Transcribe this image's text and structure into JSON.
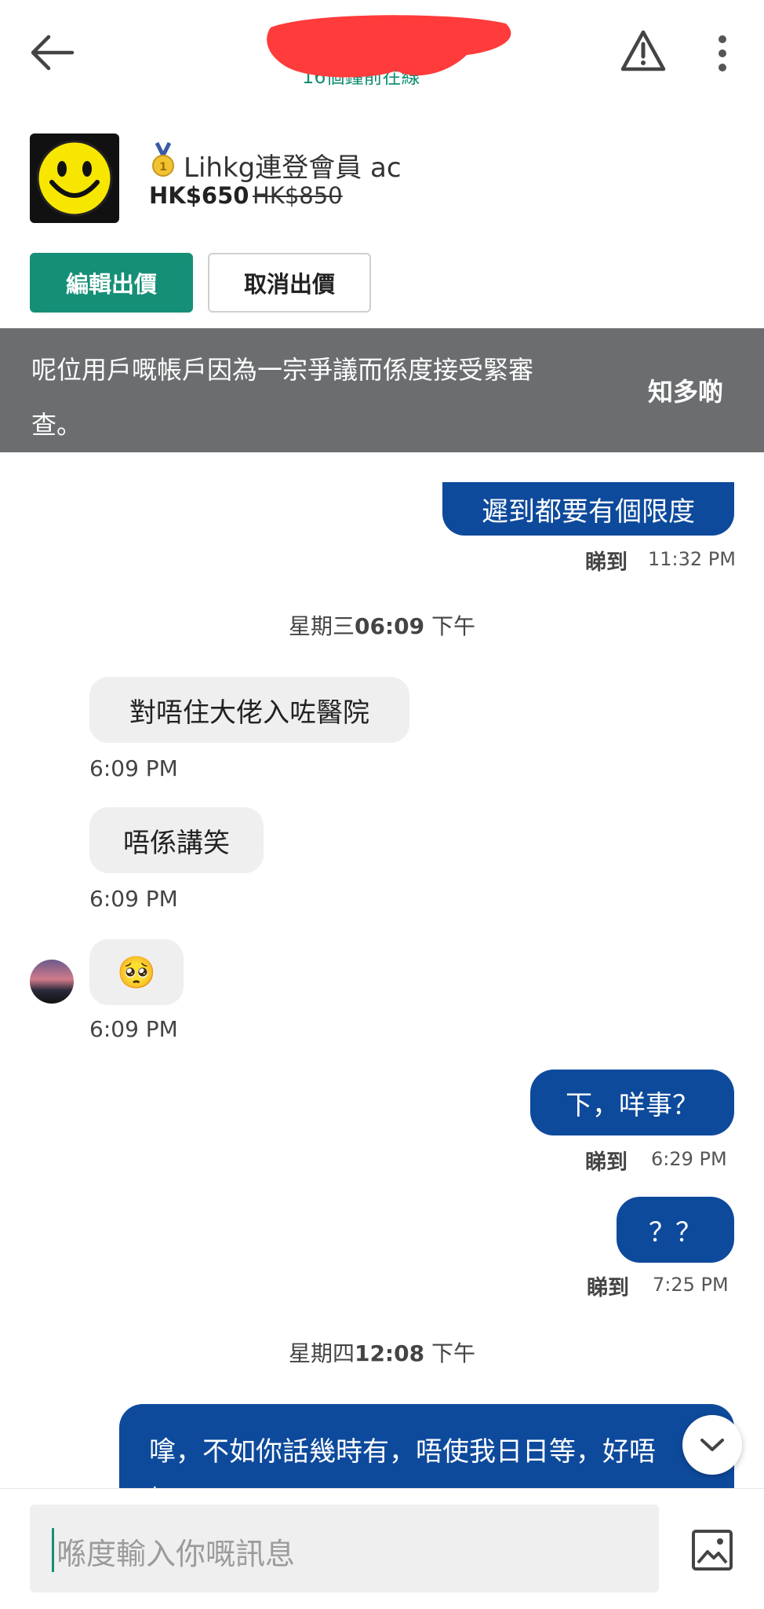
{
  "header": {
    "subtitle": "16個鐘前在線"
  },
  "listing": {
    "title": "Lihkg連登會員 ac",
    "price": "HK$650",
    "original_price": "HK$850",
    "edit_button": "編輯出價",
    "cancel_button": "取消出價"
  },
  "banner": {
    "text": "呢位用戶嘅帳戶因為一宗爭議而係度接受緊審查。",
    "link": "知多啲"
  },
  "messages": [
    {
      "from": "me",
      "text": "遲到都要有個限度",
      "status": "睇到",
      "time": "11:32 PM"
    },
    {
      "type": "date",
      "day": "星期三",
      "time": "06:09",
      "period": "下午"
    },
    {
      "from": "them",
      "text": "對唔住大佬入咗醫院",
      "time": "6:09 PM"
    },
    {
      "from": "them",
      "text": "唔係講笑",
      "time": "6:09 PM"
    },
    {
      "from": "them",
      "text": "🥺",
      "time": "6:09 PM"
    },
    {
      "from": "me",
      "text": "下，咩事？",
      "status": "睇到",
      "time": "6:29 PM"
    },
    {
      "from": "me",
      "text": "？？",
      "status": "睇到",
      "time": "7:25 PM"
    },
    {
      "type": "date",
      "day": "星期四",
      "time": "12:08",
      "period": "下午"
    },
    {
      "from": "me",
      "text": "嗱，不如你話幾時有，唔使我日日等，好唔好？"
    }
  ],
  "composer": {
    "placeholder": "喺度輸入你嘅訊息"
  },
  "icons": {
    "back": "arrow-left-icon",
    "report": "warning-triangle-icon",
    "menu": "more-vertical-icon",
    "attach": "image-icon",
    "scroll": "chevron-down-icon"
  },
  "colors": {
    "brand": "#168f77",
    "bubble_out": "#0e4a9c",
    "banner": "#6b6d6f"
  }
}
